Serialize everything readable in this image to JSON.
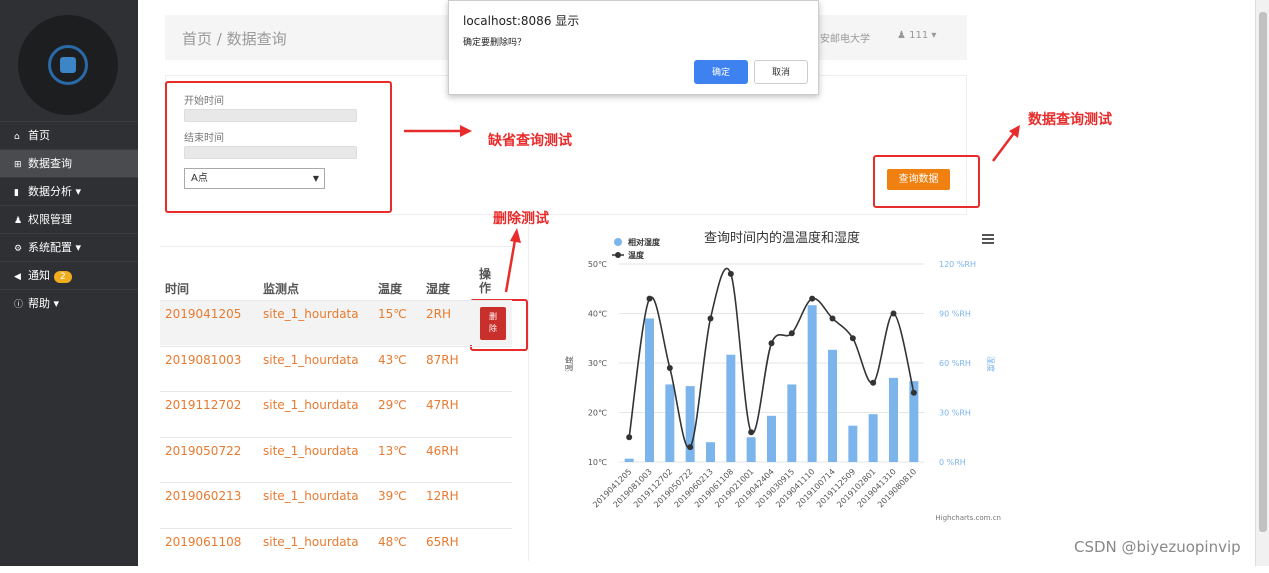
{
  "dialog": {
    "title": "localhost:8086 显示",
    "message": "确定要删除吗？",
    "ok_label": "确定",
    "cancel_label": "取消"
  },
  "sidebar": {
    "items": [
      {
        "icon": "home-icon",
        "label": "首页"
      },
      {
        "icon": "sitemap-icon",
        "label": "数据查询"
      },
      {
        "icon": "bar-chart-icon",
        "label": "数据分析 ▾"
      },
      {
        "icon": "users-icon",
        "label": "权限管理"
      },
      {
        "icon": "cogs-icon",
        "label": "系统配置 ▾"
      },
      {
        "icon": "bullhorn-icon",
        "label": "通知",
        "badge": "2"
      },
      {
        "icon": "info-icon",
        "label": "帮助 ▾"
      }
    ]
  },
  "header": {
    "breadcrumb": "首页  /  数据查询",
    "school": "安邮电大学",
    "user": "111 ▾"
  },
  "form": {
    "start_label": "开始时间",
    "end_label": "结束时间",
    "point_value": "A点",
    "query_button": "查询数据"
  },
  "annotations": {
    "default_query": "缺省查询测试",
    "data_query": "数据查询测试",
    "delete_test": "删除测试"
  },
  "table": {
    "headers": [
      "时间",
      "监测点",
      "温度",
      "湿度",
      "操作"
    ],
    "rows": [
      [
        "2019041205",
        "site_1_hourdata",
        "15℃",
        "2RH"
      ],
      [
        "2019081003",
        "site_1_hourdata",
        "43℃",
        "87RH"
      ],
      [
        "2019112702",
        "site_1_hourdata",
        "29℃",
        "47RH"
      ],
      [
        "2019050722",
        "site_1_hourdata",
        "13℃",
        "46RH"
      ],
      [
        "2019060213",
        "site_1_hourdata",
        "39℃",
        "12RH"
      ],
      [
        "2019061108",
        "site_1_hourdata",
        "48℃",
        "65RH"
      ]
    ],
    "delete_label": "删除"
  },
  "chart_data": {
    "type": "bar",
    "title": "查询时间内的温温度和湿度",
    "categories": [
      "2019041205",
      "2019081003",
      "2019112702",
      "2019050722",
      "2019060213",
      "2019061108",
      "2019021001",
      "2019042404",
      "2019030915",
      "2019041110",
      "2019100714",
      "2019112509",
      "2019102801",
      "2019041310",
      "2019080810"
    ],
    "series": [
      {
        "name": "相对湿度",
        "type": "bar",
        "axis": "right",
        "color": "#7cb5ec",
        "values": [
          2,
          87,
          47,
          46,
          12,
          65,
          15,
          28,
          47,
          95,
          68,
          22,
          29,
          51,
          49
        ]
      },
      {
        "name": "温度",
        "type": "line",
        "axis": "left",
        "color": "#333333",
        "values": [
          15,
          43,
          29,
          13,
          39,
          48,
          16,
          34,
          36,
          43,
          39,
          35,
          26,
          40,
          24
        ]
      }
    ],
    "y_left": {
      "label": "温度",
      "ylim": [
        10,
        50
      ],
      "ticks": [
        "10℃",
        "20℃",
        "30℃",
        "40℃",
        "50℃"
      ]
    },
    "y_right": {
      "label": "湿度",
      "ylim": [
        0,
        120
      ],
      "ticks": [
        "0 %RH",
        "30 %RH",
        "60 %RH",
        "90 %RH",
        "120 %RH"
      ]
    },
    "credits": "Highcharts.com.cn",
    "legend": "top-left"
  },
  "watermark": "CSDN @biyezuopinvip"
}
